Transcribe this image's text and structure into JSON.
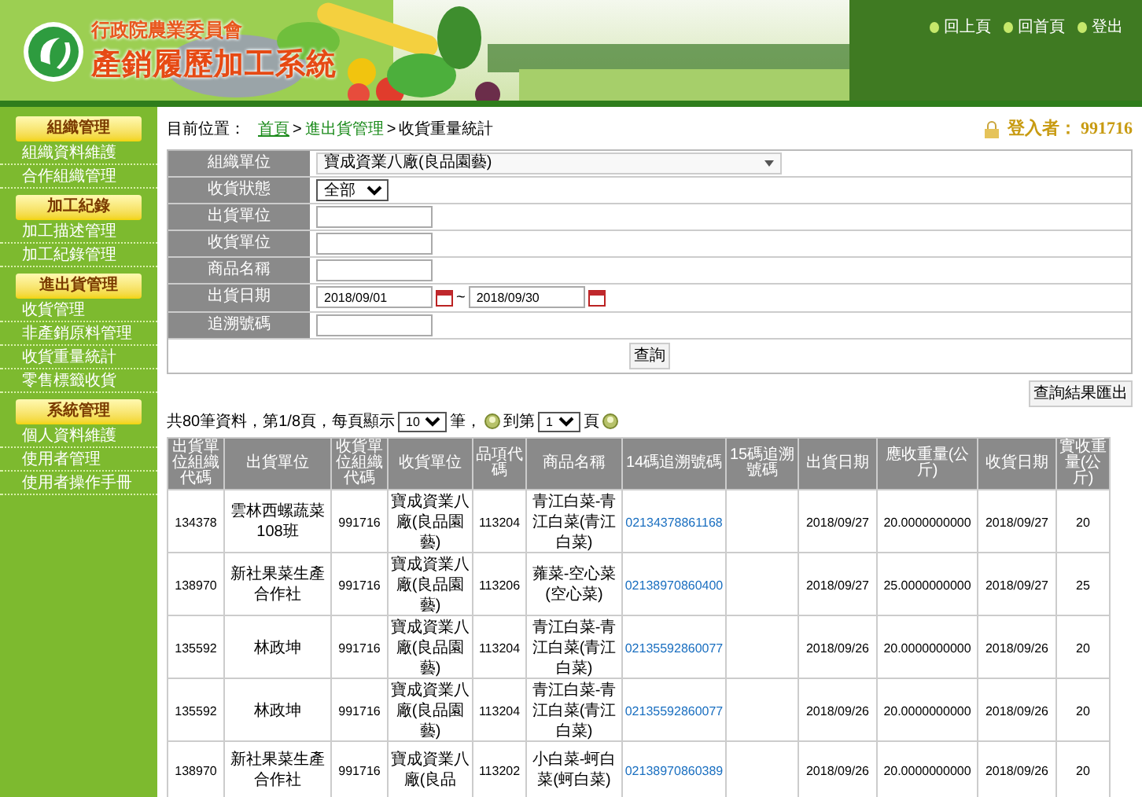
{
  "header": {
    "org": "行政院農業委員會",
    "system": "產銷履歷加工系統",
    "nav": [
      {
        "label": "回上頁"
      },
      {
        "label": "回首頁"
      },
      {
        "label": "登出"
      }
    ]
  },
  "sidebar": [
    {
      "title": "組織管理",
      "items": [
        {
          "label": "組織資料維護"
        },
        {
          "label": "合作組織管理"
        }
      ]
    },
    {
      "title": "加工紀錄",
      "items": [
        {
          "label": "加工描述管理"
        },
        {
          "label": "加工紀錄管理"
        }
      ]
    },
    {
      "title": "進出貨管理",
      "items": [
        {
          "label": "收貨管理"
        },
        {
          "label": "非產銷原料管理"
        },
        {
          "label": "收貨重量統計"
        },
        {
          "label": "零售標籤收貨"
        }
      ]
    },
    {
      "title": "系統管理",
      "items": [
        {
          "label": "個人資料維護"
        },
        {
          "label": "使用者管理"
        },
        {
          "label": "使用者操作手冊"
        }
      ]
    }
  ],
  "breadcrumb": {
    "prefix": "目前位置：",
    "links": [
      "首頁",
      "進出貨管理"
    ],
    "separator": ">",
    "current": "收貨重量統計"
  },
  "login": "登入者： 991716",
  "form": [
    {
      "label": "組織單位",
      "kind": "dropdown",
      "value": "寶成資業八廠(良品園藝)"
    },
    {
      "label": "收貨狀態",
      "kind": "select",
      "value": "全部"
    },
    {
      "label": "出貨單位",
      "kind": "text"
    },
    {
      "label": "收貨單位",
      "kind": "text"
    },
    {
      "label": "商品名稱",
      "kind": "text"
    },
    {
      "label": "出貨日期",
      "kind": "daterange",
      "from": "2018/09/01",
      "separator": "~",
      "to": "2018/09/30"
    },
    {
      "label": "追溯號碼",
      "kind": "text"
    }
  ],
  "query_button": "查詢",
  "export_button": "查詢結果匯出",
  "pager": {
    "summary": "共80筆資料，第1/8頁，每頁顯示",
    "page_size": "10",
    "after_size": "筆，",
    "goto": "到第",
    "page": "1",
    "after_page": "頁"
  },
  "table": {
    "columns": [
      "出貨單位組織代碼",
      "出貨單位",
      "收貨單位組織代碼",
      "收貨單位",
      "品項代碼",
      "商品名稱",
      "14碼追溯號碼",
      "15碼追溯號碼",
      "出貨日期",
      "應收重量(公斤)",
      "收貨日期",
      "實收重量(公斤)"
    ],
    "rows": [
      [
        "134378",
        "雲林西螺蔬菜108班",
        "991716",
        "寶成資業八廠(良品園藝)",
        "113204",
        "青江白菜-青江白菜(青江白菜)",
        "02134378861168",
        "",
        "2018/09/27",
        "20.0000000000",
        "2018/09/27",
        "20"
      ],
      [
        "138970",
        "新社果菜生產合作社",
        "991716",
        "寶成資業八廠(良品園藝)",
        "113206",
        "蕹菜-空心菜(空心菜)",
        "02138970860400",
        "",
        "2018/09/27",
        "25.0000000000",
        "2018/09/27",
        "25"
      ],
      [
        "135592",
        "林政坤",
        "991716",
        "寶成資業八廠(良品園藝)",
        "113204",
        "青江白菜-青江白菜(青江白菜)",
        "02135592860077",
        "",
        "2018/09/26",
        "20.0000000000",
        "2018/09/26",
        "20"
      ],
      [
        "135592",
        "林政坤",
        "991716",
        "寶成資業八廠(良品園藝)",
        "113204",
        "青江白菜-青江白菜(青江白菜)",
        "02135592860077",
        "",
        "2018/09/26",
        "20.0000000000",
        "2018/09/26",
        "20"
      ],
      [
        "138970",
        "新社果菜生產合作社",
        "991716",
        "寶成資業八廠(良品",
        "113202",
        "小白菜-蚵白菜(蚵白菜)",
        "02138970860389",
        "",
        "2018/09/26",
        "20.0000000000",
        "2018/09/26",
        "20"
      ]
    ]
  }
}
